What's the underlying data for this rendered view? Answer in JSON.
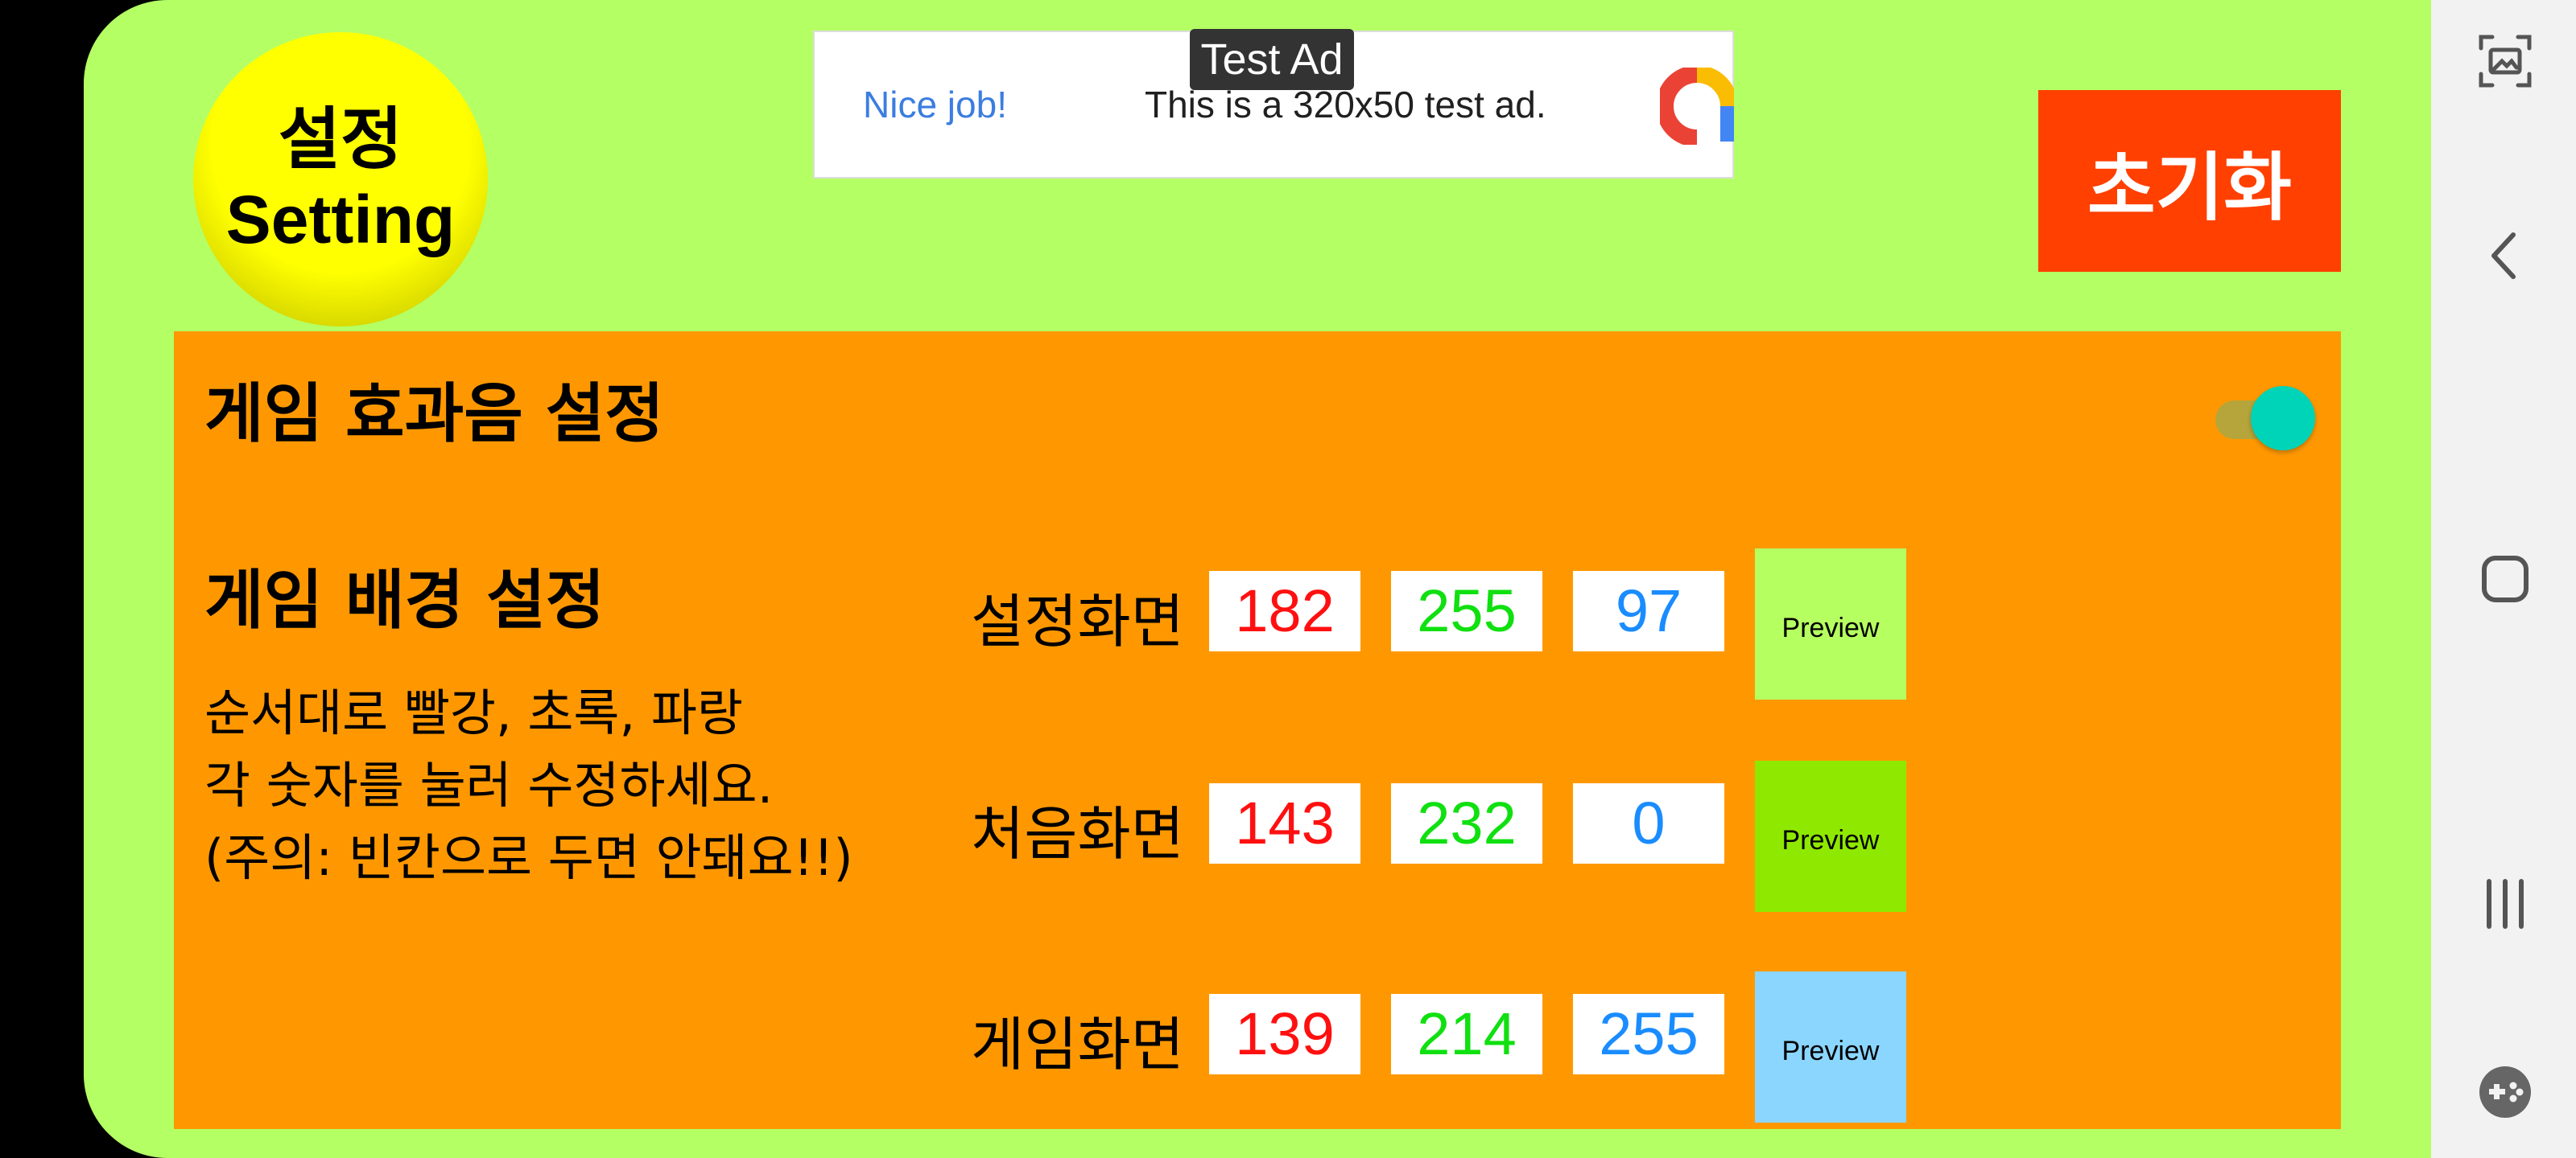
{
  "badge": {
    "line1": "설정",
    "line2": "Setting"
  },
  "ad": {
    "badge": "Test Ad",
    "headline": "Nice job!",
    "body": "This is a 320x50 test ad."
  },
  "reset_button": "초기화",
  "sound": {
    "label": "게임 효과음 설정",
    "enabled": true
  },
  "background": {
    "label": "게임 배경 설정",
    "instructions": [
      "순서대로 빨강, 초록, 파랑",
      "각 숫자를 눌러 수정하세요.",
      "(주의: 빈칸으로 두면 안돼요!!)"
    ],
    "preview_label": "Preview",
    "rows": [
      {
        "label": "설정화면",
        "r": "182",
        "g": "255",
        "b": "97",
        "color": "#b6ff61"
      },
      {
        "label": "처음화면",
        "r": "143",
        "g": "232",
        "b": "0",
        "color": "#8fe800"
      },
      {
        "label": "게임화면",
        "r": "139",
        "g": "214",
        "b": "255",
        "color": "#8bd6ff"
      }
    ]
  },
  "colors": {
    "app_bg": "#b4ff64",
    "panel": "#ff9800",
    "reset": "#ff4000",
    "toggle_thumb": "#00d4b8"
  },
  "nav_icons": [
    "screenshot-icon",
    "back-icon",
    "home-icon",
    "recents-icon",
    "game-tools-icon"
  ]
}
